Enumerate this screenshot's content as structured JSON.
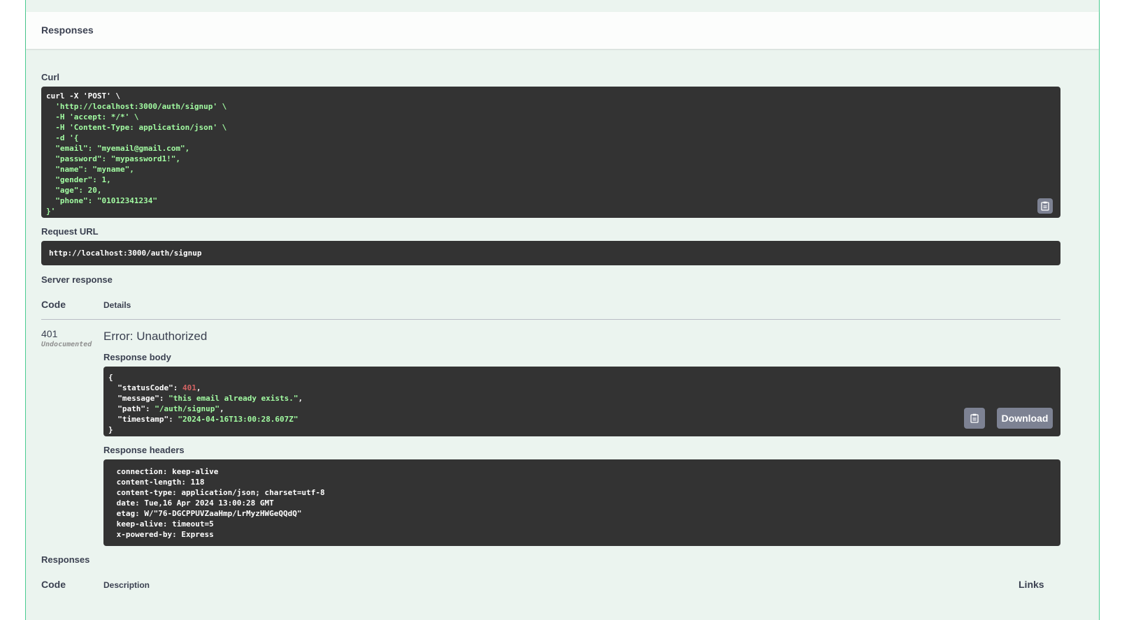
{
  "responses_header": "Responses",
  "curl": {
    "label": "Curl",
    "lines": [
      "curl -X 'POST' \\",
      "  'http://localhost:3000/auth/signup' \\",
      "  -H 'accept: */*' \\",
      "  -H 'Content-Type: application/json' \\",
      "  -d '{",
      "  \"email\": \"myemail@gmail.com\",",
      "  \"password\": \"mypassword1!\",",
      "  \"name\": \"myname\",",
      "  \"gender\": 1,",
      "  \"age\": 20,",
      "  \"phone\": \"01012341234\"",
      "}'"
    ]
  },
  "request_url": {
    "label": "Request URL",
    "value": "http://localhost:3000/auth/signup"
  },
  "server_response": {
    "label": "Server response",
    "col_code": "Code",
    "col_details": "Details",
    "code": "401",
    "undocumented": "Undocumented",
    "error_title": "Error: Unauthorized",
    "body_label": "Response body",
    "body": {
      "open": "{",
      "status_key": "\"statusCode\"",
      "status_val": "401",
      "message_key": "\"message\"",
      "message_val": "\"this email already exists.\"",
      "path_key": "\"path\"",
      "path_val": "\"/auth/signup\"",
      "timestamp_key": "\"timestamp\"",
      "timestamp_val": "\"2024-04-16T13:00:28.607Z\"",
      "close": "}"
    },
    "download_label": "Download",
    "headers_label": "Response headers",
    "headers": [
      " connection: keep-alive ",
      " content-length: 118 ",
      " content-type: application/json; charset=utf-8 ",
      " date: Tue,16 Apr 2024 13:00:28 GMT ",
      " etag: W/\"76-DGCPPUVZaaHmp/LrMyzHWGeQQdQ\" ",
      " keep-alive: timeout=5 ",
      " x-powered-by: Express "
    ]
  },
  "responses_section": {
    "label": "Responses",
    "col_code": "Code",
    "col_description": "Description",
    "col_links": "Links"
  },
  "icons": {
    "copy": "clipboard-copy-icon"
  },
  "colors": {
    "post_border": "#49cc90",
    "post_bg": "#ebf4ef",
    "code_bg": "#333333",
    "string": "#a2fca2",
    "number": "#d36363",
    "button": "#7d8293"
  }
}
